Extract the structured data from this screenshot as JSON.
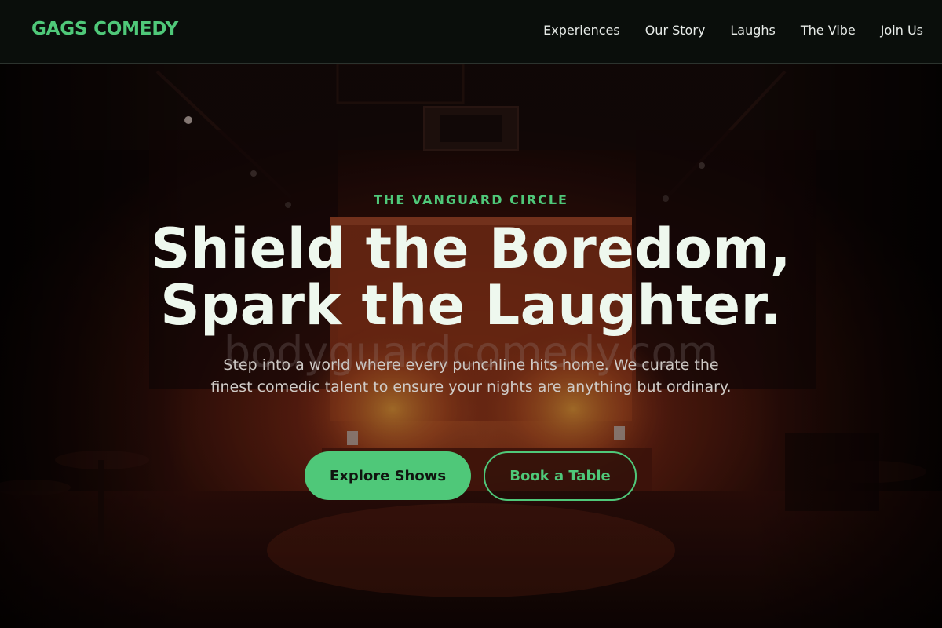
{
  "brand": {
    "logo_text": "GAGS COMEDY",
    "accent_color": "#4fc879"
  },
  "nav": {
    "items": [
      {
        "label": "Experiences"
      },
      {
        "label": "Our Story"
      },
      {
        "label": "Laughs"
      },
      {
        "label": "The Vibe"
      },
      {
        "label": "Join Us"
      }
    ]
  },
  "hero": {
    "eyebrow": "THE VANGUARD CIRCLE",
    "headline_line1": "Shield the Boredom,",
    "headline_line2": "Spark the Laughter.",
    "watermark": "bodyguardcomedy.com",
    "lede": "Step into a world where every punchline hits home. We curate the finest comedic talent to ensure your nights are anything but ordinary.",
    "primary_cta": "Explore Shows",
    "secondary_cta": "Book a Table"
  }
}
